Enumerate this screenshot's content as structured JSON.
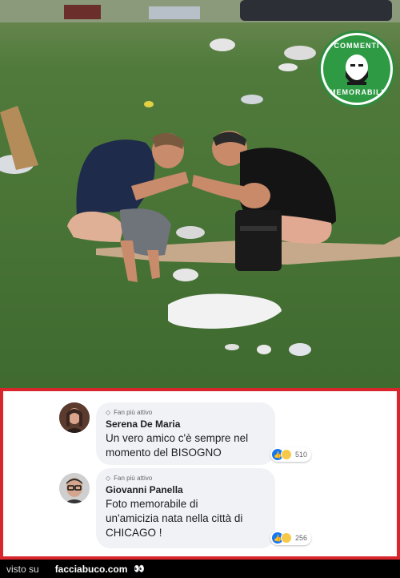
{
  "badge": {
    "top_text": "COMMENTI",
    "bottom_text": "MEMORABILI"
  },
  "comments": [
    {
      "badge_label": "Fan più attivo",
      "author": "Serena De Maria",
      "lines": [
        "Un vero amico c'è sempre nel",
        "momento del BISOGNO"
      ],
      "reaction_count": "510"
    },
    {
      "badge_label": "Fan più attivo",
      "author": "Giovanni Panella",
      "lines": [
        "Foto memorabile di",
        "un'amicizia nata nella città di",
        "CHICAGO !"
      ],
      "reaction_count": "256"
    }
  ],
  "footer": {
    "visto": "visto su",
    "site": "facciabuco.com",
    "eyes": "👀"
  }
}
